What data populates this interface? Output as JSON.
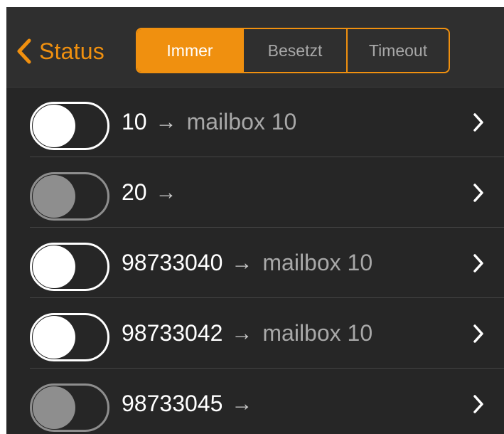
{
  "colors": {
    "accent": "#f0900f",
    "background": "#262626",
    "navbar": "#2f2f2f",
    "toggle_off_disabled": "#8e8e8e"
  },
  "navbar": {
    "back_icon": "chevron-left-icon",
    "back_label": "Status",
    "segments": [
      {
        "label": "Immer",
        "selected": true
      },
      {
        "label": "Besetzt",
        "selected": false
      },
      {
        "label": "Timeout",
        "selected": false
      }
    ]
  },
  "rows": [
    {
      "number": "10",
      "arrow": "→",
      "target": "mailbox 10",
      "toggle": "off",
      "enabled": true,
      "disclosure_icon": "chevron-right-icon"
    },
    {
      "number": "20",
      "arrow": "→",
      "target": "",
      "toggle": "off",
      "enabled": false,
      "disclosure_icon": "chevron-right-icon"
    },
    {
      "number": "98733040",
      "arrow": "→",
      "target": "mailbox 10",
      "toggle": "off",
      "enabled": true,
      "disclosure_icon": "chevron-right-icon"
    },
    {
      "number": "98733042",
      "arrow": "→",
      "target": "mailbox 10",
      "toggle": "off",
      "enabled": true,
      "disclosure_icon": "chevron-right-icon"
    },
    {
      "number": "98733045",
      "arrow": "→",
      "target": "",
      "toggle": "off",
      "enabled": false,
      "disclosure_icon": "chevron-right-icon"
    }
  ]
}
